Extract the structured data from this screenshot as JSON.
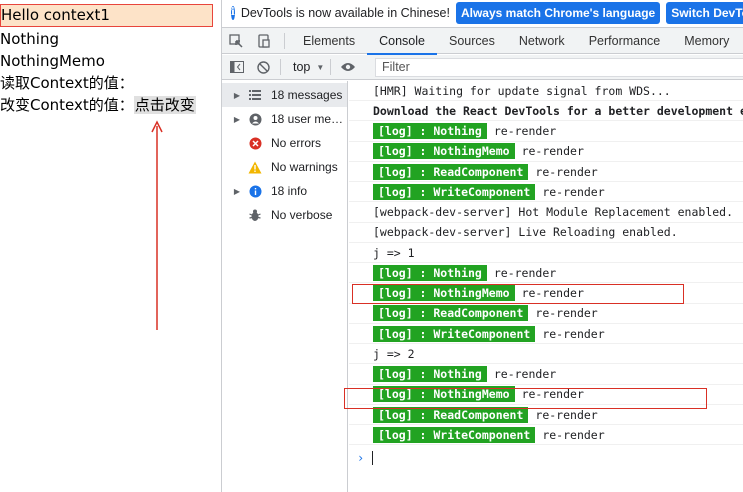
{
  "app": {
    "hello": "Hello context1",
    "lines": [
      "Nothing",
      "NothingMemo",
      "读取Context的值："
    ],
    "change_label": "改变Context的值：",
    "change_button": "点击改变"
  },
  "devtools": {
    "infobar": {
      "text": "DevTools is now available in Chinese!",
      "btn_match": "Always match Chrome's language",
      "btn_switch": "Switch DevTools"
    },
    "tabs": [
      "Elements",
      "Console",
      "Sources",
      "Network",
      "Performance",
      "Memory"
    ],
    "active_tab": "Console",
    "toolbar": {
      "context": "top",
      "filter_placeholder": "Filter"
    },
    "sidebar": [
      {
        "label": "18 messages",
        "icon": "list-icon",
        "expandable": true
      },
      {
        "label": "18 user me…",
        "icon": "user-icon",
        "expandable": true
      },
      {
        "label": "No errors",
        "icon": "error-icon",
        "expandable": false
      },
      {
        "label": "No warnings",
        "icon": "warning-icon",
        "expandable": false
      },
      {
        "label": "18 info",
        "icon": "info-icon",
        "expandable": true
      },
      {
        "label": "No verbose",
        "icon": "bug-icon",
        "expandable": false
      }
    ],
    "console": [
      {
        "text": "[HMR] Waiting for update signal from WDS..."
      },
      {
        "text": "Download the React DevTools for a better development experience",
        "bold": true
      },
      {
        "badge": "[log] : Nothing",
        "text": "re-render"
      },
      {
        "badge": "[log] : NothingMemo",
        "text": "re-render"
      },
      {
        "badge": "[log] : ReadComponent",
        "text": "re-render"
      },
      {
        "badge": "[log] : WriteComponent",
        "text": "re-render"
      },
      {
        "text": "[webpack-dev-server] Hot Module Replacement enabled."
      },
      {
        "text": "[webpack-dev-server] Live Reloading enabled."
      },
      {
        "text": "j =>  1"
      },
      {
        "badge": "[log] : Nothing",
        "text": "re-render"
      },
      {
        "badge": "[log] : NothingMemo",
        "text": "re-render"
      },
      {
        "badge": "[log] : ReadComponent",
        "text": "re-render"
      },
      {
        "badge": "[log] : WriteComponent",
        "text": "re-render"
      },
      {
        "text": "j =>  2"
      },
      {
        "badge": "[log] : Nothing",
        "text": "re-render"
      },
      {
        "badge": "[log] : NothingMemo",
        "text": "re-render"
      },
      {
        "badge": "[log] : ReadComponent",
        "text": "re-render"
      },
      {
        "badge": "[log] : WriteComponent",
        "text": "re-render"
      }
    ],
    "prompt": "›"
  },
  "colors": {
    "log_badge": "#22a322",
    "accent": "#1a73e8",
    "annotation": "#d93025"
  }
}
